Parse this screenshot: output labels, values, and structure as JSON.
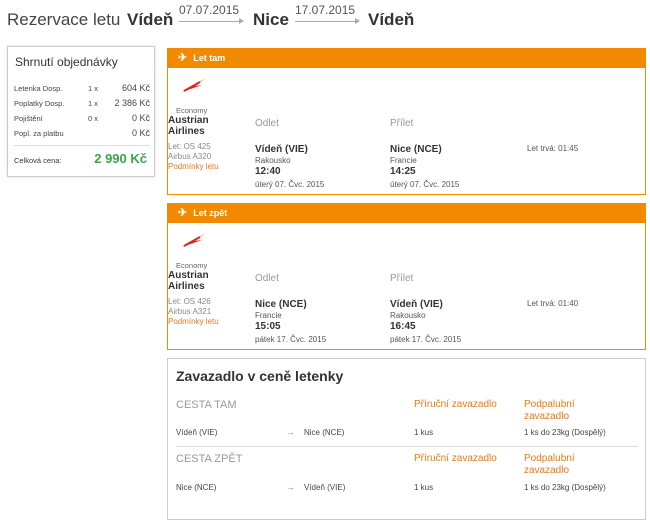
{
  "header": {
    "prefix": "Rezervace letu",
    "from_city": "Vídeň",
    "to_city": "Nice",
    "return_city": "Vídeň",
    "date_out": "07.07.2015",
    "date_back": "17.07.2015"
  },
  "summary": {
    "title": "Shrnutí objednávky",
    "rows": [
      {
        "label": "Letenka Dosp.",
        "qty": "1 x",
        "value": "604 Kč"
      },
      {
        "label": "Poplatky Dosp.",
        "qty": "1 x",
        "value": "2 386 Kč"
      },
      {
        "label": "Pojištění",
        "qty": "0 x",
        "value": "0 Kč"
      },
      {
        "label": "Popl. za platbu",
        "qty": "",
        "value": "0 Kč"
      }
    ],
    "total_label": "Celková cena:",
    "total_value": "2 990 Kč"
  },
  "outbound": {
    "heading": "Let tam",
    "class": "Economy",
    "airline": "Austrian Airlines",
    "flight_no": "Let: OS 425",
    "aircraft": "Airbus A320",
    "conditions": "Podmínky letu",
    "dep_label": "Odlet",
    "arr_label": "Přílet",
    "dep_city": "Vídeň (VIE)",
    "dep_country": "Rakousko",
    "dep_time": "12:40",
    "dep_date": "úterý 07. Čvc. 2015",
    "arr_city": "Nice (NCE)",
    "arr_country": "Francie",
    "arr_time": "14:25",
    "arr_date": "úterý 07. Čvc. 2015",
    "duration": "Let trvá: 01:45"
  },
  "inbound": {
    "heading": "Let zpět",
    "class": "Economy",
    "airline": "Austrian Airlines",
    "flight_no": "Let: OS 426",
    "aircraft": "Airbus A321",
    "conditions": "Podmínky letu",
    "dep_label": "Odlet",
    "arr_label": "Přílet",
    "dep_city": "Nice (NCE)",
    "dep_country": "Francie",
    "dep_time": "15:05",
    "dep_date": "pátek 17. Čvc. 2015",
    "arr_city": "Vídeň (VIE)",
    "arr_country": "Rakousko",
    "arr_time": "16:45",
    "arr_date": "pátek 17. Čvc. 2015",
    "duration": "Let trvá: 01:40"
  },
  "baggage": {
    "title": "Zavazadlo v ceně letenky",
    "cabin_label": "Příruční zavazadlo",
    "hold_label_1": "Podpalubní",
    "hold_label_2": "zavazadlo",
    "rows": [
      {
        "direction": "CESTA TAM",
        "from": "Vídeň (VIE)",
        "to": "Nice (NCE)",
        "cabin": "1 kus",
        "hold": "1 ks do 23kg (Dospělý)"
      },
      {
        "direction": "CESTA ZPĚT",
        "from": "Nice (NCE)",
        "to": "Vídeň (VIE)",
        "cabin": "1 kus",
        "hold": "1 ks do 23kg (Dospělý)"
      }
    ]
  },
  "colors": {
    "accent": "#f18a00",
    "total": "#3aa34a",
    "link": "#e87a1e"
  },
  "icons": {
    "plane": "airplane-icon",
    "logo": "austrian-airlines-logo"
  }
}
